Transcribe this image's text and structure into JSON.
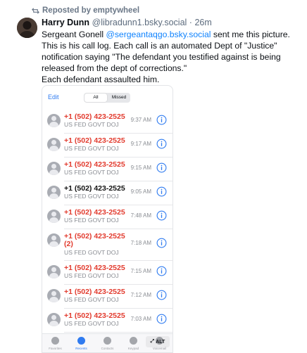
{
  "repost": {
    "label": "Reposted by emptywheel"
  },
  "post": {
    "author_name": "Harry Dunn",
    "author_handle": "@libradunn1.bsky.social",
    "separator": "·",
    "age": "26m",
    "text_before_mention": "Sergeant Gonell ",
    "mention": "@sergeantaqgo.bsky.social",
    "text_after_mention": " sent me this picture. This is his call log. Each call is an automated Dept of \"Justice\" notification saying \"The defendant you testified against is being released from the dept of corrections.\"",
    "text_line2": "Each defendant assaulted him."
  },
  "phone": {
    "edit_label": "Edit",
    "segments": [
      "All",
      "Missed"
    ],
    "active_segment": "All",
    "calls": [
      {
        "number": "+1 (502) 423-2525",
        "label": "US FED GOVT DOJ",
        "time": "9:37 AM",
        "missed": true
      },
      {
        "number": "+1 (502) 423-2525",
        "label": "US FED GOVT DOJ",
        "time": "9:17 AM",
        "missed": true
      },
      {
        "number": "+1 (502) 423-2525",
        "label": "US FED GOVT DOJ",
        "time": "9:15 AM",
        "missed": true
      },
      {
        "number": "+1 (502) 423-2525",
        "label": "US FED GOVT DOJ",
        "time": "9:05 AM",
        "missed": false
      },
      {
        "number": "+1 (502) 423-2525",
        "label": "US FED GOVT DOJ",
        "time": "7:48 AM",
        "missed": true
      },
      {
        "number": "+1 (502) 423-2525",
        "count": "(2)",
        "label": "US FED GOVT DOJ",
        "time": "7:18 AM",
        "missed": true
      },
      {
        "number": "+1 (502) 423-2525",
        "label": "US FED GOVT DOJ",
        "time": "7:15 AM",
        "missed": true
      },
      {
        "number": "+1 (502) 423-2525",
        "label": "US FED GOVT DOJ",
        "time": "7:12 AM",
        "missed": true
      },
      {
        "number": "+1 (502) 423-2525",
        "label": "US FED GOVT DOJ",
        "time": "7:03 AM",
        "missed": true
      }
    ],
    "tabs": [
      "Favorites",
      "Recents",
      "Contacts",
      "Keypad",
      "Voicemail"
    ],
    "active_tab": "Recents"
  },
  "alt_badge": "ALT",
  "colors": {
    "accent": "#1083fe",
    "missed": "#e23b2e",
    "ios_blue": "#2f7bf0"
  }
}
